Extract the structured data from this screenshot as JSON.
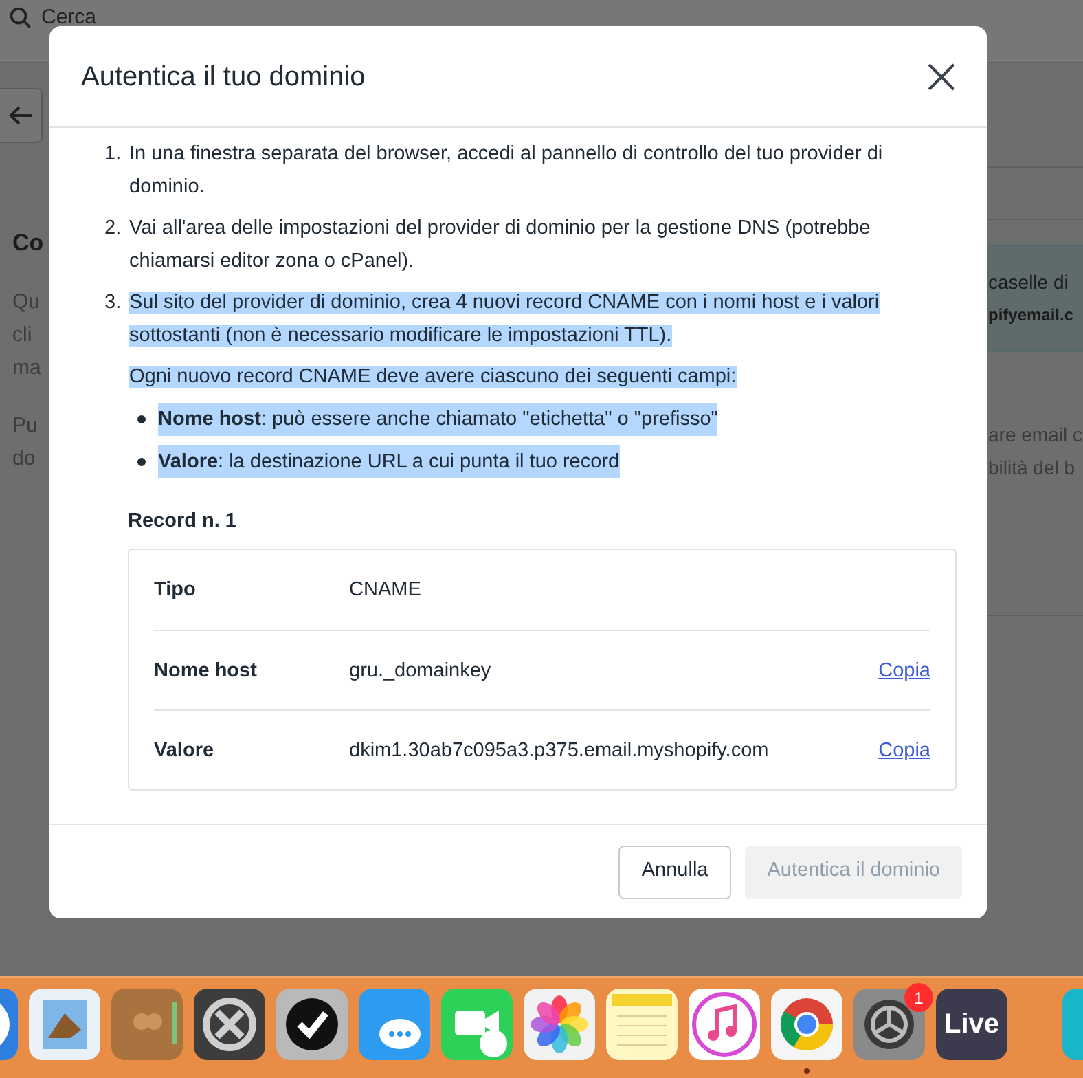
{
  "background": {
    "search": {
      "placeholder": "Cerca"
    },
    "left_heading": "Co",
    "left_paragraphs": [
      [
        "Qu",
        "cli",
        "ma"
      ],
      [
        "Pu",
        "do"
      ]
    ],
    "right_notice": [
      "caselle di",
      "pifyemail.c"
    ],
    "right_paragraph": [
      "are email c",
      "bilità del b"
    ]
  },
  "dialog": {
    "title": "Autentica il tuo dominio",
    "steps": [
      {
        "number": "1.",
        "text": "In una finestra separata del browser, accedi al pannello di controllo del tuo provider di dominio.",
        "highlighted": false
      },
      {
        "number": "2.",
        "text": "Vai all'area delle impostazioni del provider di dominio per la gestione DNS (potrebbe chiamarsi editor zona o cPanel).",
        "highlighted": false
      },
      {
        "number": "3.",
        "text": "Sul sito del provider di dominio, crea 4 nuovi record CNAME con i nomi host e i valori sottostanti (non è necessario modificare le impostazioni TTL).",
        "highlighted": true,
        "note": "Ogni nuovo record CNAME deve avere ciascuno dei seguenti campi:",
        "bullets": [
          {
            "text": "**Nome host**: può essere anche chiamato \"etichetta\" o \"prefisso\"",
            "highlighted": true
          },
          {
            "text": "**Valore**: la destinazione URL a cui punta il tuo record",
            "highlighted": true
          }
        ]
      }
    ],
    "record": {
      "title": "Record n. 1",
      "rows": [
        {
          "label": "Tipo",
          "value": "CNAME"
        },
        {
          "label": "Nome host",
          "value": "gru._domainkey",
          "action": "Copia"
        },
        {
          "label": "Valore",
          "value": "dkim1.30ab7c095a3.p375.email.myshopify.com",
          "action": "Copia"
        }
      ]
    },
    "buttons": [
      {
        "label": "Annulla",
        "disabled": false
      },
      {
        "label": "Autentica il dominio",
        "disabled": true
      }
    ]
  },
  "dock": {
    "apps": [
      {
        "kind": "compass",
        "color": "#2f7fe0",
        "running": false
      },
      {
        "kind": "stamp",
        "color": "#eaf1f8",
        "running": false
      },
      {
        "kind": "book",
        "color": "#a8733f",
        "running": false
      },
      {
        "kind": "cross",
        "color": "#3d3d3d",
        "running": false
      },
      {
        "kind": "check",
        "color": "#b9b9b9",
        "running": false
      },
      {
        "kind": "chat",
        "color": "#2d9bf0",
        "running": false
      },
      {
        "kind": "video",
        "color": "#2ed158",
        "running": false
      },
      {
        "kind": "flower",
        "color": "#f2f2f2",
        "running": false
      },
      {
        "kind": "notepad",
        "color": "#fff7c4",
        "running": false
      },
      {
        "kind": "music",
        "color": "#ffffff",
        "running": false
      },
      {
        "kind": "browser",
        "color": "#f5f5f5",
        "running": true
      },
      {
        "kind": "gear",
        "color": "#8a8a8a",
        "running": false,
        "badge": "1"
      },
      {
        "kind": "text",
        "color": "#3c3a4e",
        "running": false,
        "label": "Live"
      },
      {
        "kind": "gradient",
        "color": "#18b6c8",
        "running": false
      }
    ]
  }
}
